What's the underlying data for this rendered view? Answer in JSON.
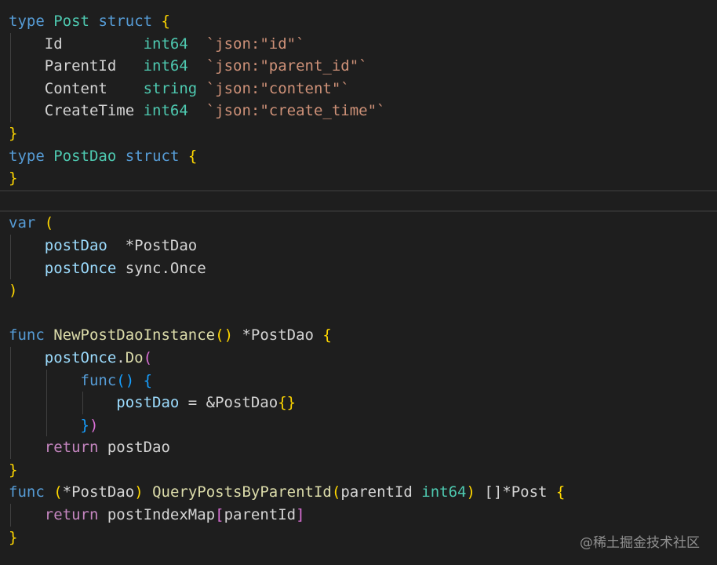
{
  "colors": {
    "background": "#1e1e1e",
    "keyword": "#569cd6",
    "control_keyword": "#c586c0",
    "type": "#4ec9b0",
    "function": "#dcdcaa",
    "variable": "#9cdcfe",
    "string": "#ce9178",
    "plain": "#d4d4d4",
    "bracket_level_1": "#ffd700",
    "bracket_level_2": "#da70d6",
    "bracket_level_3": "#179fff"
  },
  "code_lines": [
    {
      "indent": 0,
      "tokens": [
        {
          "t": "type",
          "c": "kw"
        },
        {
          "t": " ",
          "c": "plain"
        },
        {
          "t": "Post",
          "c": "type"
        },
        {
          "t": " ",
          "c": "plain"
        },
        {
          "t": "struct",
          "c": "kw"
        },
        {
          "t": " ",
          "c": "plain"
        },
        {
          "t": "{",
          "c": "b1"
        }
      ]
    },
    {
      "indent": 1,
      "tokens": [
        {
          "t": "Id         ",
          "c": "plain"
        },
        {
          "t": "int64",
          "c": "type"
        },
        {
          "t": "  ",
          "c": "plain"
        },
        {
          "t": "`json:\"id\"`",
          "c": "str"
        }
      ]
    },
    {
      "indent": 1,
      "tokens": [
        {
          "t": "ParentId   ",
          "c": "plain"
        },
        {
          "t": "int64",
          "c": "type"
        },
        {
          "t": "  ",
          "c": "plain"
        },
        {
          "t": "`json:\"parent_id\"`",
          "c": "str"
        }
      ]
    },
    {
      "indent": 1,
      "tokens": [
        {
          "t": "Content    ",
          "c": "plain"
        },
        {
          "t": "string",
          "c": "type"
        },
        {
          "t": " ",
          "c": "plain"
        },
        {
          "t": "`json:\"content\"`",
          "c": "str"
        }
      ]
    },
    {
      "indent": 1,
      "tokens": [
        {
          "t": "CreateTime ",
          "c": "plain"
        },
        {
          "t": "int64",
          "c": "type"
        },
        {
          "t": "  ",
          "c": "plain"
        },
        {
          "t": "`json:\"create_time\"`",
          "c": "str"
        }
      ]
    },
    {
      "indent": 0,
      "tokens": [
        {
          "t": "}",
          "c": "b1"
        }
      ]
    },
    {
      "indent": 0,
      "tokens": [
        {
          "t": "type",
          "c": "kw"
        },
        {
          "t": " ",
          "c": "plain"
        },
        {
          "t": "PostDao",
          "c": "type"
        },
        {
          "t": " ",
          "c": "plain"
        },
        {
          "t": "struct",
          "c": "kw"
        },
        {
          "t": " ",
          "c": "plain"
        },
        {
          "t": "{",
          "c": "b1"
        }
      ]
    },
    {
      "indent": 0,
      "tokens": [
        {
          "t": "}",
          "c": "b1"
        }
      ]
    },
    {
      "indent": 0,
      "current": true,
      "tokens": []
    },
    {
      "indent": 0,
      "tokens": [
        {
          "t": "var",
          "c": "kw"
        },
        {
          "t": " ",
          "c": "plain"
        },
        {
          "t": "(",
          "c": "b1"
        }
      ]
    },
    {
      "indent": 1,
      "tokens": [
        {
          "t": "postDao",
          "c": "var"
        },
        {
          "t": "  *PostDao",
          "c": "plain"
        }
      ]
    },
    {
      "indent": 1,
      "tokens": [
        {
          "t": "postOnce",
          "c": "var"
        },
        {
          "t": " sync.Once",
          "c": "plain"
        }
      ]
    },
    {
      "indent": 0,
      "tokens": [
        {
          "t": ")",
          "c": "b1"
        }
      ]
    },
    {
      "indent": 0,
      "tokens": []
    },
    {
      "indent": 0,
      "tokens": [
        {
          "t": "func",
          "c": "kw"
        },
        {
          "t": " ",
          "c": "plain"
        },
        {
          "t": "NewPostDaoInstance",
          "c": "fn"
        },
        {
          "t": "()",
          "c": "b1"
        },
        {
          "t": " *PostDao ",
          "c": "plain"
        },
        {
          "t": "{",
          "c": "b1"
        }
      ]
    },
    {
      "indent": 1,
      "tokens": [
        {
          "t": "postOnce",
          "c": "var"
        },
        {
          "t": ".",
          "c": "plain"
        },
        {
          "t": "Do",
          "c": "fn"
        },
        {
          "t": "(",
          "c": "b2"
        }
      ]
    },
    {
      "indent": 2,
      "tokens": [
        {
          "t": "func",
          "c": "kw"
        },
        {
          "t": "()",
          "c": "b3"
        },
        {
          "t": " ",
          "c": "plain"
        },
        {
          "t": "{",
          "c": "b3"
        }
      ]
    },
    {
      "indent": 3,
      "tokens": [
        {
          "t": "postDao",
          "c": "var"
        },
        {
          "t": " = &PostDao",
          "c": "plain"
        },
        {
          "t": "{}",
          "c": "b1"
        }
      ]
    },
    {
      "indent": 2,
      "tokens": [
        {
          "t": "}",
          "c": "b3"
        },
        {
          "t": ")",
          "c": "b2"
        }
      ]
    },
    {
      "indent": 1,
      "tokens": [
        {
          "t": "return",
          "c": "ctl"
        },
        {
          "t": " postDao",
          "c": "plain"
        }
      ]
    },
    {
      "indent": 0,
      "tokens": [
        {
          "t": "}",
          "c": "b1"
        }
      ]
    },
    {
      "indent": 0,
      "tokens": [
        {
          "t": "func",
          "c": "kw"
        },
        {
          "t": " ",
          "c": "plain"
        },
        {
          "t": "(",
          "c": "b1"
        },
        {
          "t": "*PostDao",
          "c": "plain"
        },
        {
          "t": ")",
          "c": "b1"
        },
        {
          "t": " ",
          "c": "plain"
        },
        {
          "t": "QueryPostsByParentId",
          "c": "fn"
        },
        {
          "t": "(",
          "c": "b1"
        },
        {
          "t": "parentId",
          "c": "plain"
        },
        {
          "t": " ",
          "c": "plain"
        },
        {
          "t": "int64",
          "c": "type"
        },
        {
          "t": ")",
          "c": "b1"
        },
        {
          "t": " []*Post ",
          "c": "plain"
        },
        {
          "t": "{",
          "c": "b1"
        }
      ]
    },
    {
      "indent": 1,
      "tokens": [
        {
          "t": "return",
          "c": "ctl"
        },
        {
          "t": " postIndexMap",
          "c": "plain"
        },
        {
          "t": "[",
          "c": "b2"
        },
        {
          "t": "parentId",
          "c": "plain"
        },
        {
          "t": "]",
          "c": "b2"
        }
      ]
    },
    {
      "indent": 0,
      "tokens": [
        {
          "t": "}",
          "c": "b1"
        }
      ]
    }
  ],
  "watermark": "@稀土掘金技术社区"
}
